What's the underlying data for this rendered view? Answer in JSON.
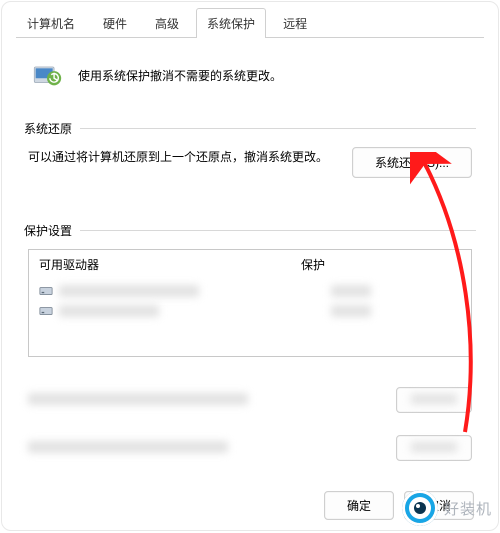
{
  "tabs": {
    "items": [
      {
        "label": "计算机名"
      },
      {
        "label": "硬件"
      },
      {
        "label": "高级"
      },
      {
        "label": "系统保护"
      },
      {
        "label": "远程"
      }
    ],
    "active_index": 3
  },
  "intro": {
    "text": "使用系统保护撤消不需要的系统更改。"
  },
  "sections": {
    "restore": {
      "title": "系统还原",
      "desc": "可以通过将计算机还原到上一个还原点，撤消系统更改。",
      "button": "系统还原(S)..."
    },
    "protect": {
      "title": "保护设置",
      "columns": {
        "drive": "可用驱动器",
        "protection": "保护"
      }
    }
  },
  "footer": {
    "ok": "确定",
    "cancel": "取消"
  },
  "watermark": {
    "text": "好装机"
  }
}
